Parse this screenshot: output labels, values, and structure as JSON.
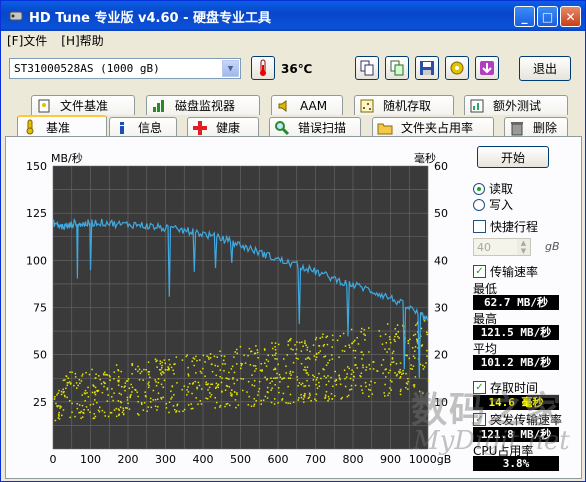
{
  "window": {
    "title": "HD Tune 专业版 v4.60 - 硬盘专业工具"
  },
  "menu": {
    "file": "[F]文件",
    "help": "[H]帮助"
  },
  "toolbar": {
    "drive": "ST31000528AS (1000 gB)",
    "temperature": "36℃",
    "exit_label": "退出"
  },
  "tabs_top": [
    {
      "label": "文件基准",
      "icon": "file-benchmark-icon"
    },
    {
      "label": "磁盘监视器",
      "icon": "disk-monitor-icon"
    },
    {
      "label": "AAM",
      "icon": "speaker-icon"
    },
    {
      "label": "随机存取",
      "icon": "random-access-icon"
    },
    {
      "label": "额外测试",
      "icon": "extra-tests-icon"
    }
  ],
  "tabs_bottom": [
    {
      "label": "基准",
      "icon": "benchmark-icon",
      "active": true
    },
    {
      "label": "信息",
      "icon": "info-icon"
    },
    {
      "label": "健康",
      "icon": "health-cross-icon"
    },
    {
      "label": "错误扫描",
      "icon": "magnifier-icon"
    },
    {
      "label": "文件夹占用率",
      "icon": "folder-icon"
    },
    {
      "label": "删除",
      "icon": "trash-icon"
    }
  ],
  "side": {
    "start_label": "开始",
    "read_label": "读取",
    "write_label": "写入",
    "quick_label": "快捷行程",
    "quick_value": "40",
    "quick_unit": "gB",
    "transfer_label": "传输速率",
    "min_label": "最低",
    "min_value": "62.7 MB/秒",
    "max_label": "最高",
    "max_value": "121.5 MB/秒",
    "avg_label": "平均",
    "avg_value": "101.2 MB/秒",
    "access_label": "存取时间",
    "access_value": "14.6 毫秒",
    "burst_label": "突发传输速率",
    "burst_value": "121.8 MB/秒",
    "cpu_label": "CPU占用率",
    "cpu_value": "3.8%"
  },
  "watermark": {
    "line1": "数码之家",
    "line2": "MyDigit.net"
  },
  "chart_data": {
    "type": "line",
    "ylabel_left": "MB/秒",
    "ylabel_right": "毫秒",
    "xlabel": "",
    "x_unit_label": "1000gB",
    "ylim_left": [
      0,
      150
    ],
    "ylim_right": [
      0,
      60
    ],
    "xlim": [
      0,
      1000
    ],
    "x_ticks": [
      0,
      100,
      200,
      300,
      400,
      500,
      600,
      700,
      800,
      900
    ],
    "y_ticks_left": [
      25,
      50,
      75,
      100,
      125,
      150
    ],
    "y_ticks_right": [
      10,
      20,
      30,
      40,
      50,
      60
    ],
    "grid": true,
    "colors": {
      "transfer": "#3FA9E0",
      "access": "#E6E600",
      "background": "#3A3A3A",
      "grid": "#6A6A6A"
    },
    "series": [
      {
        "name": "传输速率",
        "x": [
          0,
          20,
          40,
          60,
          80,
          100,
          140,
          180,
          220,
          260,
          300,
          340,
          380,
          420,
          460,
          500,
          540,
          580,
          620,
          660,
          700,
          740,
          780,
          820,
          860,
          900,
          940,
          980,
          1000
        ],
        "y": [
          120,
          118,
          118,
          120,
          119,
          120,
          120,
          119,
          119,
          118,
          117,
          116,
          115,
          113,
          111,
          108,
          105,
          102,
          99,
          97,
          94,
          91,
          88,
          86,
          83,
          80,
          76,
          71,
          68
        ]
      },
      {
        "name": "存取时间",
        "type": "scatter",
        "x_range": [
          0,
          1000
        ],
        "y_start_range_ms": [
          6,
          16
        ],
        "y_end_range_ms": [
          12,
          28
        ]
      }
    ]
  }
}
